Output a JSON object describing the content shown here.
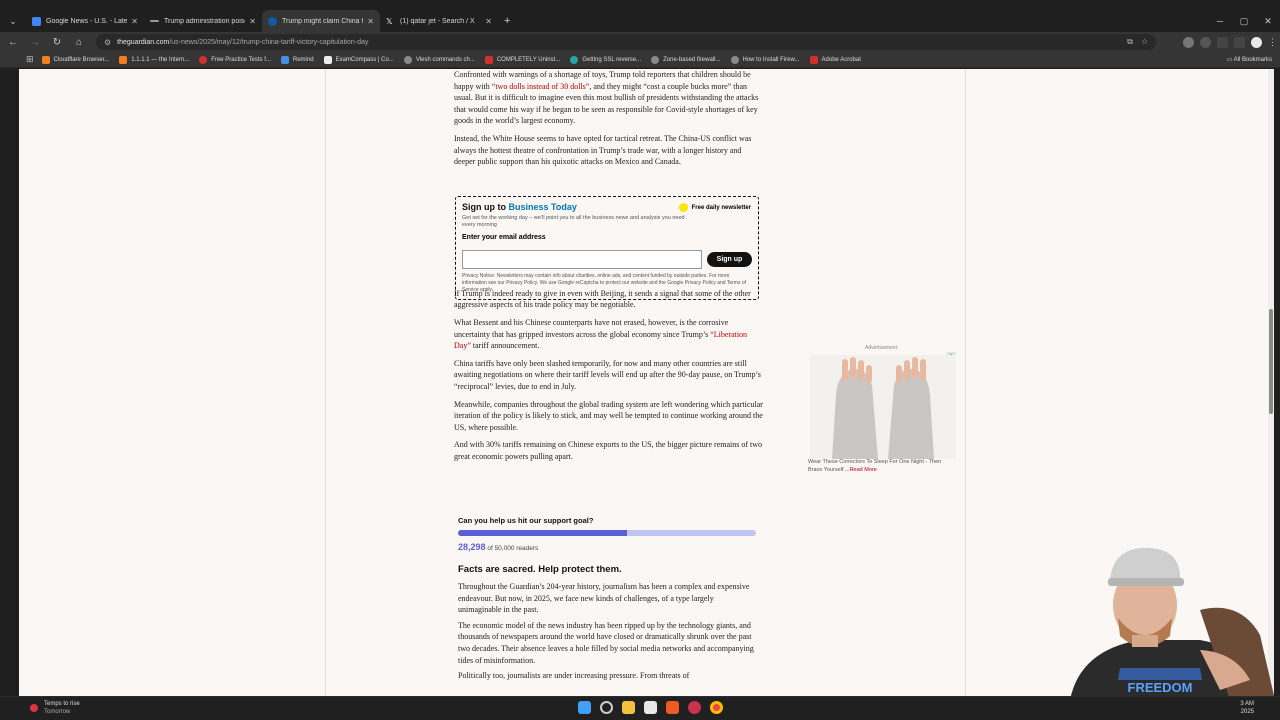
{
  "tabs": [
    {
      "title": "Google News - U.S. - Latest",
      "active": false,
      "color": "#4285f4"
    },
    {
      "title": "Trump administration poised to",
      "active": false,
      "color": "#a0a0a0"
    },
    {
      "title": "Trump might claim China tariff",
      "active": true,
      "color": "#0e5aa7"
    },
    {
      "title": "(1) qatar jet - Search / X",
      "active": false,
      "color": "#ffffff"
    }
  ],
  "url": {
    "domain": "theguardian.com",
    "path": "/us-news/2025/may/12/trump-china-tariff-victory-capitulation-day"
  },
  "bookmarks": [
    "Cloudflare Browser...",
    "1.1.1.1 — the Intern...",
    "Free Practice Tests f...",
    "Remind",
    "ExamCompass | Co...",
    "Vlesh commands ch...",
    "COMPLETELY Uninst...",
    "Getting SSL reverse...",
    "Zone-based firewall...",
    "How to Install Firew...",
    "Adobe Acrobat"
  ],
  "all_bookmarks": "All Bookmarks",
  "article": {
    "p1": "Confronted with warnings of a shortage of toys, Trump told reporters that children should be happy with",
    "p1_link": "“two dolls instead of 30 dolls”",
    "p1_rest": ", and they might “cost a couple bucks more” than usual. But it is difficult to imagine even this most bullish of presidents withstanding the attacks that would come his way if he began to be seen as responsible for Covid-style shortages of key goods in the world’s largest economy.",
    "p2": "Instead, the White House seems to have opted for tactical retreat. The China-US conflict was always the hottest theatre of confrontation in Trump’s trade war, with a longer history and deeper public support than his quixotic attacks on Mexico and Canada.",
    "p3": "If Trump is indeed ready to give in even with Beijing, it sends a signal that some of the other aggressive aspects of his trade policy may be negotiable.",
    "p4": "What Bessent and his Chinese counterparts have not erased, however, is the corrosive uncertainty that has gripped investors across the global economy since Trump’s",
    "p4_link": "“Liberation Day”",
    "p4_rest": " tariff announcement.",
    "p5": "China tariffs have only been slashed temporarily, for now and many other countries are still awaiting negotiations on where their tariff levels will end up after the 90-day pause, on Trump’s “reciprocal” levies, due to end in July.",
    "p6": "Meanwhile, companies throughout the global trading system are left wondering which particular iteration of the policy is likely to stick, and may well be tempted to continue working around the US, where possible.",
    "p7": "And with 30% tariffs remaining on Chinese exports to the US, the bigger picture remains of two great economic powers pulling apart."
  },
  "signup": {
    "title_prefix": "Sign up to ",
    "title_brand": "Business Today",
    "badge": "Free daily newsletter",
    "desc": "Get set for the working day – we’ll point you to all the business news and analysis you need every morning",
    "label": "Enter your email address",
    "button": "Sign up",
    "privacy": "Privacy Notice: Newsletters may contain info about charities, online ads, and content funded by outside parties. For more information see our Privacy Policy. We use Google reCaptcha to protect our website and the Google Privacy Policy and Terms of Service apply."
  },
  "ad": {
    "label": "Advertisement",
    "caption": "Wear These Correctors To Sleep For One Night - Then Brace Yourself",
    "read_more": "...Read More"
  },
  "support": {
    "question": "Can you help us hit our support goal?",
    "progress": 0.566,
    "count": "28,298",
    "goal": " of 50,000 readers",
    "heading": "Facts are sacred. Help protect them.",
    "b1": "Throughout the Guardian’s 204-year history, journalism has been a complex and expensive endeavour. But now, in 2025, we face new kinds of challenges, of a type largely unimaginable in the past.",
    "b2": "The economic model of the news industry has been ripped up by the technology giants, and thousands of newspapers around the world have closed or dramatically shrunk over the past two decades. Their absence leaves a hole filled by social media networks and accompanying tides of misinformation.",
    "b3": "Politically too, journalists are under increasing pressure. From threats of"
  },
  "webcam": {
    "shirt_text": "FREEDOM"
  },
  "taskbar": {
    "weather_title": "Temps to rise",
    "weather_sub": "Tomorrow",
    "time": "3 AM",
    "date": "2025"
  }
}
